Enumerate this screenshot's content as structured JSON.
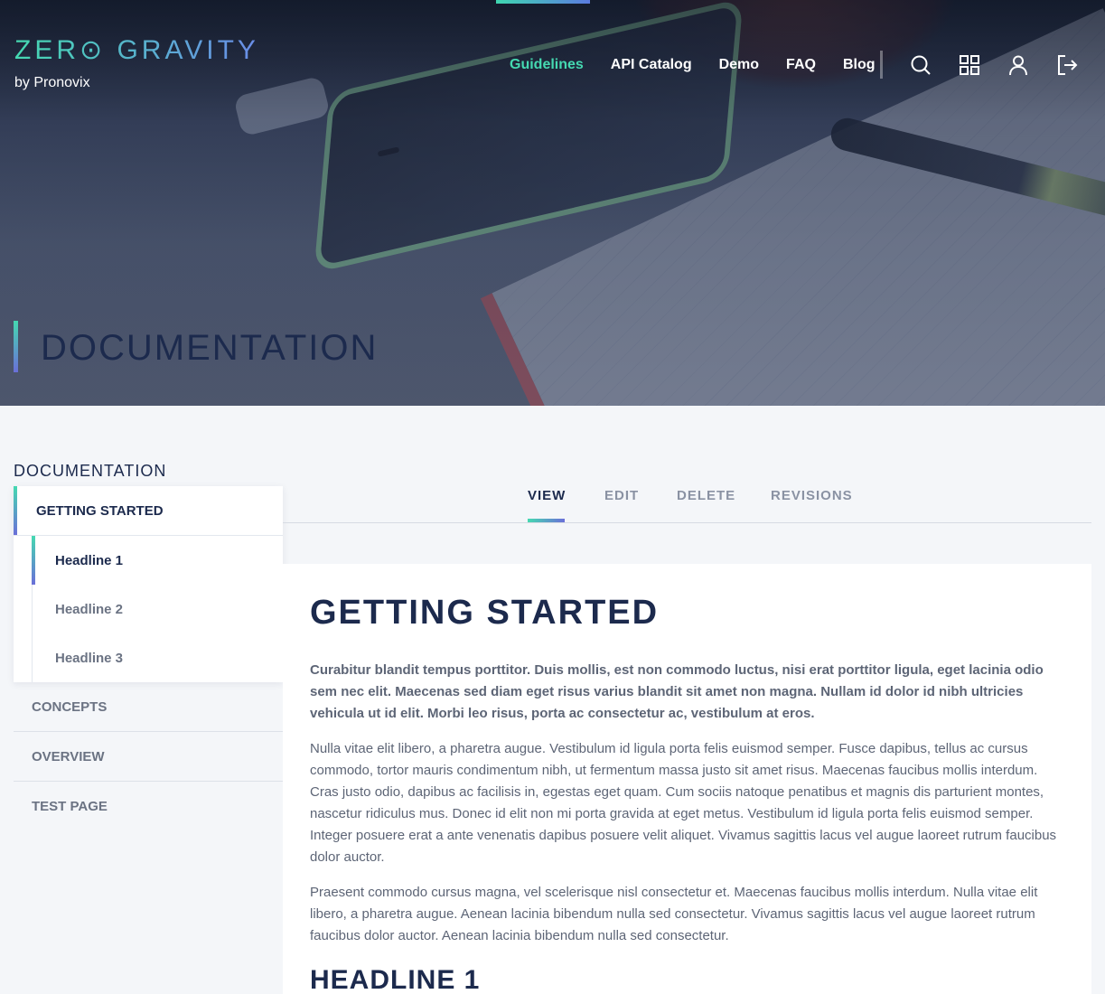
{
  "brand": {
    "name": "ZER⊙ GRAVITY",
    "by": "by Pronovix",
    "accent_gradient": [
      "#45d9b1",
      "#6a8ce8"
    ]
  },
  "nav": {
    "items": [
      "Guidelines",
      "API Catalog",
      "Demo",
      "FAQ",
      "Blog"
    ],
    "active_index": 0,
    "icons": [
      "search-icon",
      "grid-icon",
      "user-icon",
      "logout-icon"
    ]
  },
  "hero": {
    "title": "DOCUMENTATION"
  },
  "sidebar": {
    "heading": "DOCUMENTATION",
    "active_section": "GETTING STARTED",
    "sub_items": [
      "Headline 1",
      "Headline 2",
      "Headline 3"
    ],
    "other_sections": [
      "CONCEPTS",
      "OVERVIEW",
      "TEST PAGE"
    ]
  },
  "tabs": {
    "items": [
      "VIEW",
      "EDIT",
      "DELETE",
      "REVISIONS"
    ],
    "active_index": 0
  },
  "article": {
    "title": "GETTING STARTED",
    "lead": "Curabitur blandit tempus porttitor. Duis mollis, est non commodo luctus, nisi erat porttitor ligula, eget lacinia odio sem nec elit. Maecenas sed diam eget risus varius blandit sit amet non magna. Nullam id dolor id nibh ultricies vehicula ut id elit. Morbi leo risus, porta ac consectetur ac, vestibulum at eros.",
    "paragraph1": "Nulla vitae elit libero, a pharetra augue. Vestibulum id ligula porta felis euismod semper. Fusce dapibus, tellus ac cursus commodo, tortor mauris condimentum nibh, ut fermentum massa justo sit amet risus. Maecenas faucibus mollis interdum. Cras justo odio, dapibus ac facilisis in, egestas eget quam. Cum sociis natoque penatibus et magnis dis parturient montes, nascetur ridiculus mus. Donec id elit non mi porta gravida at eget metus. Vestibulum id ligula porta felis euismod semper. Integer posuere erat a ante venenatis dapibus posuere velit aliquet. Vivamus sagittis lacus vel augue laoreet rutrum faucibus dolor auctor.",
    "paragraph2": "Praesent commodo cursus magna, vel scelerisque nisl consectetur et. Maecenas faucibus mollis interdum. Nulla vitae elit libero, a pharetra augue. Aenean lacinia bibendum nulla sed consectetur. Vivamus sagittis lacus vel augue laoreet rutrum faucibus dolor auctor. Aenean lacinia bibendum nulla sed consectetur.",
    "headline1": "HEADLINE 1"
  },
  "colors": {
    "navy": "#1c2a4d",
    "teal": "#45d9b1",
    "violet": "#6a6fd8",
    "muted_text": "#6b7383",
    "page_bg": "#f4f6f9"
  }
}
